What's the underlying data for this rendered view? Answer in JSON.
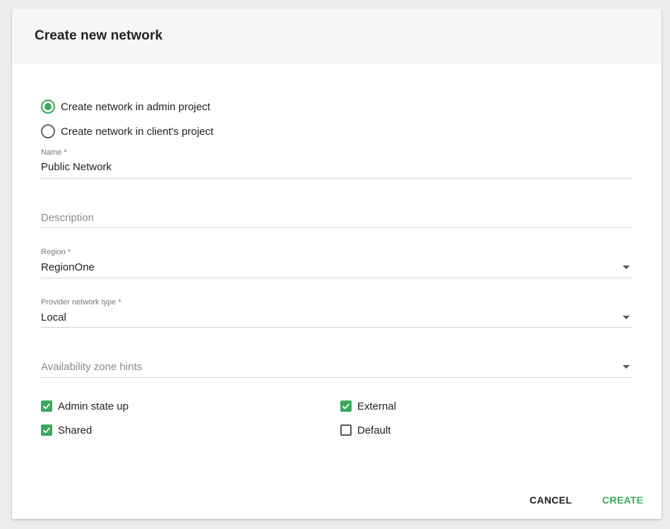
{
  "dialog": {
    "title": "Create new network"
  },
  "project_options": [
    {
      "label": "Create network in admin project",
      "checked": true
    },
    {
      "label": "Create network in client's project",
      "checked": false
    }
  ],
  "fields": {
    "name": {
      "label": "Name *",
      "value": "Public Network"
    },
    "description": {
      "placeholder": "Description",
      "value": ""
    },
    "region": {
      "label": "Region *",
      "value": "RegionOne"
    },
    "provider_network_type": {
      "label": "Provider network type *",
      "value": "Local"
    },
    "availability_zone_hints": {
      "placeholder": "Availability zone hints",
      "value": ""
    }
  },
  "checkboxes": {
    "admin_state_up": {
      "label": "Admin state up",
      "checked": true
    },
    "shared": {
      "label": "Shared",
      "checked": true
    },
    "external": {
      "label": "External",
      "checked": true
    },
    "default": {
      "label": "Default",
      "checked": false
    }
  },
  "buttons": {
    "cancel": "CANCEL",
    "create": "CREATE"
  },
  "colors": {
    "accent": "#3aaa5c",
    "header_bg": "#f6f6f6",
    "page_bg": "#ececec"
  },
  "icons": {
    "radio_checked": "radio-checked-icon",
    "radio_unchecked": "radio-unchecked-icon",
    "checkbox_checked": "checkmark-icon",
    "dropdown": "caret-down-icon"
  }
}
